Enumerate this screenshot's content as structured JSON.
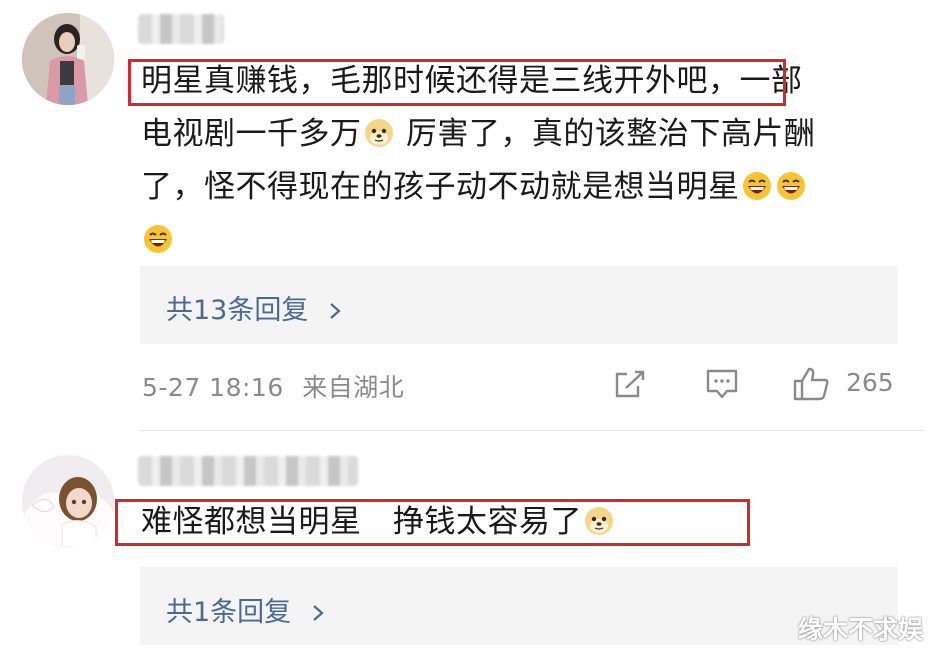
{
  "comment1": {
    "avatar": "avatar-woman-selfie",
    "line1": "明星真赚钱，毛那时候还得是三线开外吧，",
    "line1_rest": "一部",
    "line2a": "电视剧一千多万",
    "line2_emoji": "doge-emoji",
    "line2b": " 厉害了，真的该整治下高片酬",
    "line3": "了，怪不得现在的孩子动不动就是想当明星",
    "line3_emoji": "grin-emoji",
    "line4_emoji": "grin-emoji",
    "replies": "共13条回复",
    "date": "5-27 18:16",
    "location": "来自湖北",
    "likes": "265"
  },
  "comment2": {
    "avatar": "avatar-doll",
    "text": "难怪都想当明星　挣钱太容易了",
    "emoji": "doge-emoji",
    "replies": "共1条回复"
  },
  "watermark": "缘木不求娱",
  "colors": {
    "highlight": "#d9262c",
    "link": "#4a6a94",
    "meta": "#8a8a8a",
    "reply_bg": "#f4f4f4"
  }
}
